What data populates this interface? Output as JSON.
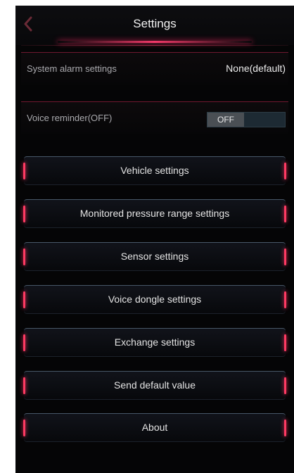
{
  "header": {
    "title": "Settings"
  },
  "alarm_row": {
    "label": "System alarm settings",
    "value": "None(default)"
  },
  "voice_row": {
    "label": "Voice reminder(OFF)",
    "toggle_text": "OFF"
  },
  "menu": [
    {
      "label": "Vehicle settings"
    },
    {
      "label": "Monitored pressure range settings"
    },
    {
      "label": "Sensor settings"
    },
    {
      "label": "Voice dongle settings"
    },
    {
      "label": "Exchange settings"
    },
    {
      "label": "Send default value"
    },
    {
      "label": "About"
    }
  ],
  "colors": {
    "background": "#050506",
    "accent": "#ff3a62",
    "text": "#e4e4e4",
    "muted_text": "#a9a9ad"
  }
}
